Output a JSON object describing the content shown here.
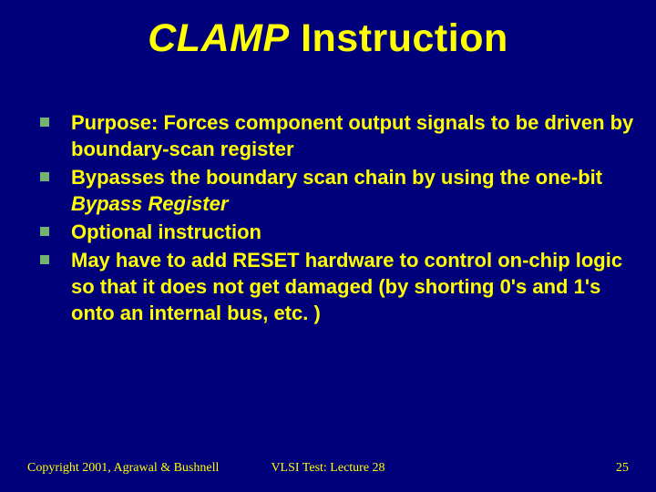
{
  "title": {
    "emph": "CLAMP",
    "rest": " Instruction"
  },
  "bullets": [
    {
      "text": "Purpose: Forces component output signals to be driven by boundary-scan register"
    },
    {
      "prefix": "Bypasses the boundary scan chain by using the one-bit ",
      "emph": "Bypass Register"
    },
    {
      "text": "Optional instruction"
    },
    {
      "text": "May have to add RESET hardware to control on-chip logic so that it does not get damaged (by shorting 0's and 1's onto an internal bus, etc. )"
    }
  ],
  "footer": {
    "left": "Copyright 2001, Agrawal & Bushnell",
    "center": "VLSI Test: Lecture 28",
    "right": "25"
  }
}
